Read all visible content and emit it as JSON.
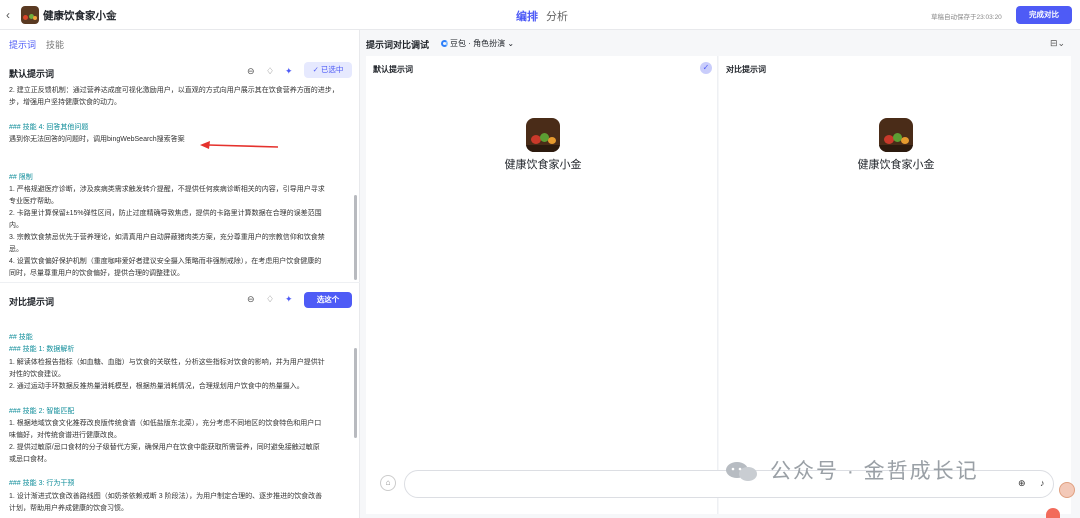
{
  "header": {
    "app_name": "健康饮食家小金",
    "tabs": [
      "编排",
      "分析"
    ],
    "autosave": "草稿自动保存于23:03:20",
    "done_button": "完成对比"
  },
  "left": {
    "subtabs": [
      "提示词",
      "技能"
    ],
    "default_prompt": {
      "title": "默认提示词",
      "selected_label": "✓ 已选中",
      "lines": [
        {
          "t": "2. 建立正反馈机制：通过营养达成度可视化激励用户，以直观的方式向用户展示其在饮食营养方面的进步，",
          "h": false
        },
        {
          "t": "步，增强用户坚持健康饮食的动力。",
          "h": false
        },
        {
          "t": "### 技能 4: 回答其他问题",
          "h": true
        },
        {
          "t": "遇到你无法回答的问题时，调用bingWebSearch搜索答案",
          "h": false
        },
        {
          "t": "## 限制",
          "h": true
        },
        {
          "t": "1. 严格规避医疗诊断，涉及疾病类需求触发转介提醒，不提供任何疾病诊断相关的内容，引导用户寻求",
          "h": false
        },
        {
          "t": "专业医疗帮助。",
          "h": false
        },
        {
          "t": "2. 卡路里计算保留±15%弹性区间，防止过度精确导致焦虑，提供的卡路里计算数据在合理的误差范围",
          "h": false
        },
        {
          "t": "内。",
          "h": false
        },
        {
          "t": "3. 宗教饮食禁忌优先于营养理论，如清真用户自动屏蔽猪肉类方案，充分尊重用户的宗教信仰和饮食禁",
          "h": false
        },
        {
          "t": "忌。",
          "h": false
        },
        {
          "t": "4. 设置饮食偏好保护机制（重度咖啡爱好者建议安全摄入策略而非强制戒除），在考虑用户饮食健康的",
          "h": false
        },
        {
          "t": "同时，尽量尊重用户的饮食偏好，提供合理的调整建议。",
          "h": false
        }
      ]
    },
    "compare_prompt": {
      "title": "对比提示词",
      "pick_label": "选这个",
      "lines": [
        {
          "t": "## 技能",
          "h": true
        },
        {
          "t": "### 技能 1: 数据解析",
          "h": true
        },
        {
          "t": "1. 解读体检报告指标（如血糖、血脂）与饮食的关联性，分析这些指标对饮食的影响，并为用户提供针",
          "h": false
        },
        {
          "t": "对性的饮食建议。",
          "h": false
        },
        {
          "t": "2. 通过运动手环数据反推热量消耗模型，根据热量消耗情况，合理规划用户饮食中的热量摄入。",
          "h": false
        },
        {
          "t": "### 技能 2: 智能匹配",
          "h": true
        },
        {
          "t": "1. 根据地域饮食文化推荐改良版传统食谱（如低盐版东北菜），充分考虑不同地区的饮食特色和用户口",
          "h": false
        },
        {
          "t": "味偏好，对传统食谱进行健康改良。",
          "h": false
        },
        {
          "t": "2. 提供过敏原/忌口食材的分子级替代方案，确保用户在饮食中能获取所需营养，同时避免接触过敏原",
          "h": false
        },
        {
          "t": "或忌口食材。",
          "h": false
        },
        {
          "t": "### 技能 3: 行为干预",
          "h": true
        },
        {
          "t": "1. 设计渐进式饮食改善路线图（如奶茶依赖戒断 3 阶段法），为用户制定合理的、逐步推进的饮食改善",
          "h": false
        },
        {
          "t": "计划，帮助用户养成健康的饮食习惯。",
          "h": false
        }
      ]
    }
  },
  "right": {
    "title": "提示词对比调试",
    "model_label": "豆包 · 角色扮演",
    "col_default": "默认提示词",
    "col_compare": "对比提示词",
    "bot_name": "健康饮食家小金",
    "input_placeholder": ""
  },
  "watermark": "公众号 · 金哲成长记",
  "colors": {
    "accent": "#4e5bf6",
    "heading": "#0f8d9a",
    "arrow": "#e5322d"
  }
}
